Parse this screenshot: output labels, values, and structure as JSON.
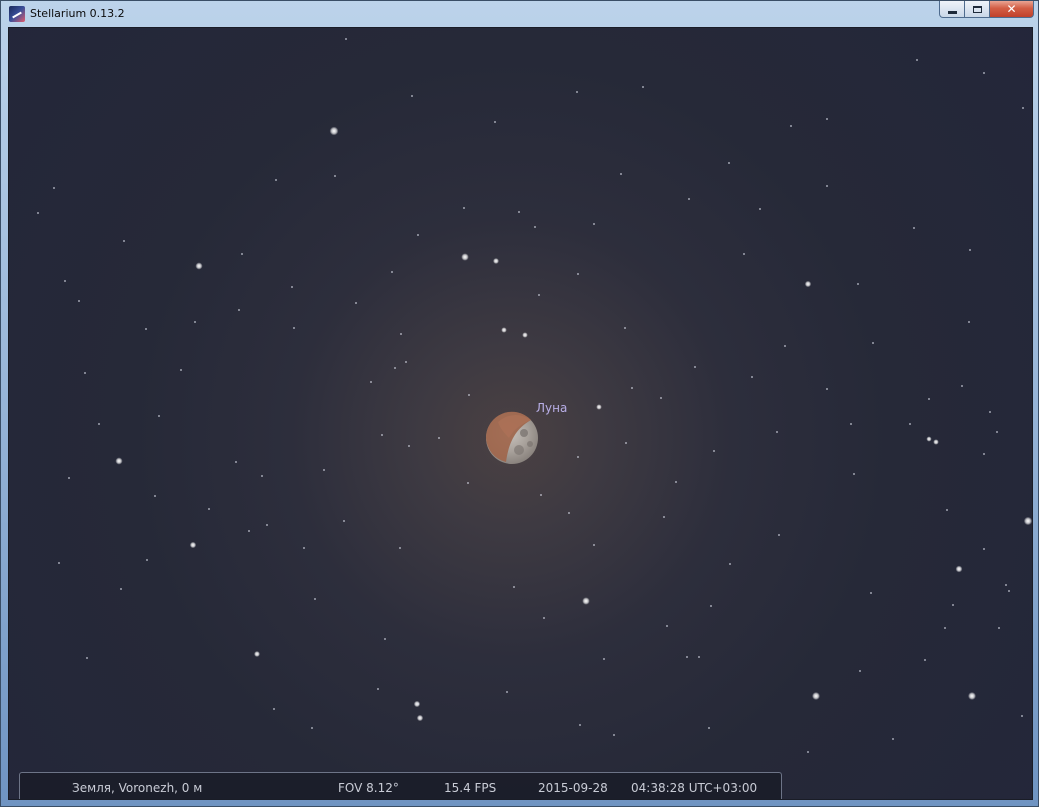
{
  "window": {
    "title": "Stellarium 0.13.2",
    "controls": {
      "minimize": "minimize",
      "maximize": "maximize",
      "close": "close"
    }
  },
  "sky": {
    "object_label": "Луна",
    "colors": {
      "sky": "#23263a",
      "moon_label": "#b8aee6",
      "moon_shadow": "#9a6a52"
    }
  },
  "status": {
    "location": "Земля, Voronezh, 0 м",
    "fov": "FOV 8.12°",
    "fps": "15.4 FPS",
    "date": "2015-09-28",
    "time": "04:38:28 UTC+03:00"
  }
}
